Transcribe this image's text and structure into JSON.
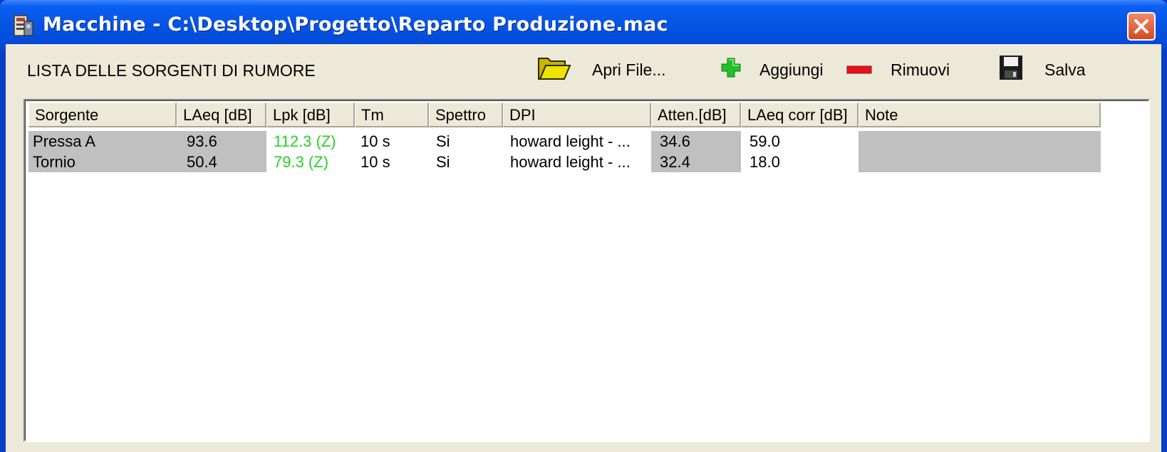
{
  "window": {
    "title": "Macchine - C:\\Desktop\\Progetto\\Reparto Produzione.mac",
    "close_icon": "close-icon"
  },
  "toolbar": {
    "heading": "LISTA DELLE SORGENTI DI RUMORE",
    "open_label": "Apri File...",
    "add_label": "Aggiungi",
    "remove_label": "Rimuovi",
    "save_label": "Salva"
  },
  "table": {
    "columns": [
      "Sorgente",
      "LAeq [dB]",
      "Lpk [dB]",
      "Tm",
      "Spettro",
      "DPI",
      "Atten.[dB]",
      "LAeq corr [dB]",
      "Note"
    ],
    "rows": [
      [
        "Pressa A",
        "93.6",
        "112.3 (Z)",
        "10 s",
        "Si",
        "howard leight - ...",
        "34.6",
        "59.0",
        ""
      ],
      [
        "Tornio",
        "50.4",
        "79.3 (Z)",
        "10 s",
        "Si",
        "howard leight - ...",
        "32.4",
        "18.0",
        ""
      ]
    ]
  },
  "colors": {
    "title_bar": "#0653e3",
    "client_bg": "#ece9d8",
    "shaded_cell": "#c0c0c0",
    "lpk_text": "#25d125",
    "add_icon": "#22c02a",
    "remove_icon": "#e8131a",
    "folder_icon": "#e8d800"
  }
}
